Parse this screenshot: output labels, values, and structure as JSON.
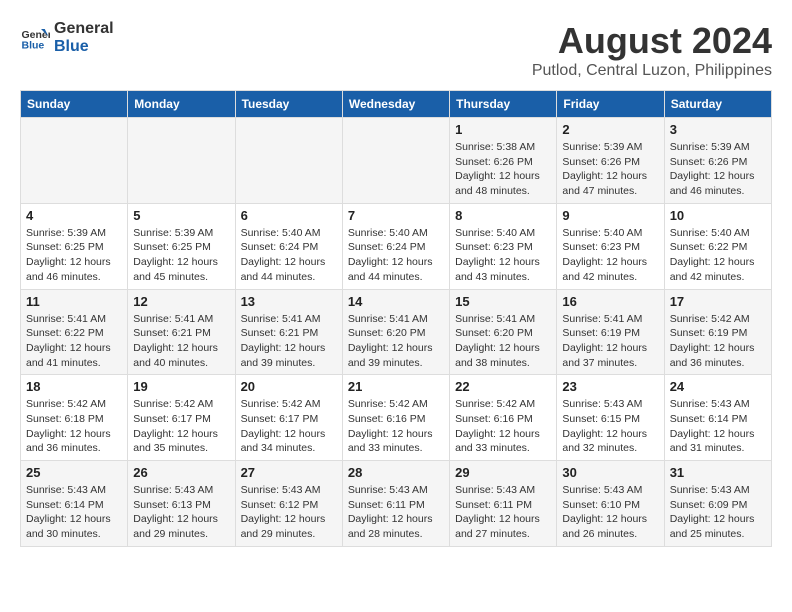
{
  "logo": {
    "line1": "General",
    "line2": "Blue"
  },
  "title": "August 2024",
  "subtitle": "Putlod, Central Luzon, Philippines",
  "days_of_week": [
    "Sunday",
    "Monday",
    "Tuesday",
    "Wednesday",
    "Thursday",
    "Friday",
    "Saturday"
  ],
  "weeks": [
    [
      {
        "day": "",
        "info": ""
      },
      {
        "day": "",
        "info": ""
      },
      {
        "day": "",
        "info": ""
      },
      {
        "day": "",
        "info": ""
      },
      {
        "day": "1",
        "info": "Sunrise: 5:38 AM\nSunset: 6:26 PM\nDaylight: 12 hours\nand 48 minutes."
      },
      {
        "day": "2",
        "info": "Sunrise: 5:39 AM\nSunset: 6:26 PM\nDaylight: 12 hours\nand 47 minutes."
      },
      {
        "day": "3",
        "info": "Sunrise: 5:39 AM\nSunset: 6:26 PM\nDaylight: 12 hours\nand 46 minutes."
      }
    ],
    [
      {
        "day": "4",
        "info": "Sunrise: 5:39 AM\nSunset: 6:25 PM\nDaylight: 12 hours\nand 46 minutes."
      },
      {
        "day": "5",
        "info": "Sunrise: 5:39 AM\nSunset: 6:25 PM\nDaylight: 12 hours\nand 45 minutes."
      },
      {
        "day": "6",
        "info": "Sunrise: 5:40 AM\nSunset: 6:24 PM\nDaylight: 12 hours\nand 44 minutes."
      },
      {
        "day": "7",
        "info": "Sunrise: 5:40 AM\nSunset: 6:24 PM\nDaylight: 12 hours\nand 44 minutes."
      },
      {
        "day": "8",
        "info": "Sunrise: 5:40 AM\nSunset: 6:23 PM\nDaylight: 12 hours\nand 43 minutes."
      },
      {
        "day": "9",
        "info": "Sunrise: 5:40 AM\nSunset: 6:23 PM\nDaylight: 12 hours\nand 42 minutes."
      },
      {
        "day": "10",
        "info": "Sunrise: 5:40 AM\nSunset: 6:22 PM\nDaylight: 12 hours\nand 42 minutes."
      }
    ],
    [
      {
        "day": "11",
        "info": "Sunrise: 5:41 AM\nSunset: 6:22 PM\nDaylight: 12 hours\nand 41 minutes."
      },
      {
        "day": "12",
        "info": "Sunrise: 5:41 AM\nSunset: 6:21 PM\nDaylight: 12 hours\nand 40 minutes."
      },
      {
        "day": "13",
        "info": "Sunrise: 5:41 AM\nSunset: 6:21 PM\nDaylight: 12 hours\nand 39 minutes."
      },
      {
        "day": "14",
        "info": "Sunrise: 5:41 AM\nSunset: 6:20 PM\nDaylight: 12 hours\nand 39 minutes."
      },
      {
        "day": "15",
        "info": "Sunrise: 5:41 AM\nSunset: 6:20 PM\nDaylight: 12 hours\nand 38 minutes."
      },
      {
        "day": "16",
        "info": "Sunrise: 5:41 AM\nSunset: 6:19 PM\nDaylight: 12 hours\nand 37 minutes."
      },
      {
        "day": "17",
        "info": "Sunrise: 5:42 AM\nSunset: 6:19 PM\nDaylight: 12 hours\nand 36 minutes."
      }
    ],
    [
      {
        "day": "18",
        "info": "Sunrise: 5:42 AM\nSunset: 6:18 PM\nDaylight: 12 hours\nand 36 minutes."
      },
      {
        "day": "19",
        "info": "Sunrise: 5:42 AM\nSunset: 6:17 PM\nDaylight: 12 hours\nand 35 minutes."
      },
      {
        "day": "20",
        "info": "Sunrise: 5:42 AM\nSunset: 6:17 PM\nDaylight: 12 hours\nand 34 minutes."
      },
      {
        "day": "21",
        "info": "Sunrise: 5:42 AM\nSunset: 6:16 PM\nDaylight: 12 hours\nand 33 minutes."
      },
      {
        "day": "22",
        "info": "Sunrise: 5:42 AM\nSunset: 6:16 PM\nDaylight: 12 hours\nand 33 minutes."
      },
      {
        "day": "23",
        "info": "Sunrise: 5:43 AM\nSunset: 6:15 PM\nDaylight: 12 hours\nand 32 minutes."
      },
      {
        "day": "24",
        "info": "Sunrise: 5:43 AM\nSunset: 6:14 PM\nDaylight: 12 hours\nand 31 minutes."
      }
    ],
    [
      {
        "day": "25",
        "info": "Sunrise: 5:43 AM\nSunset: 6:14 PM\nDaylight: 12 hours\nand 30 minutes."
      },
      {
        "day": "26",
        "info": "Sunrise: 5:43 AM\nSunset: 6:13 PM\nDaylight: 12 hours\nand 29 minutes."
      },
      {
        "day": "27",
        "info": "Sunrise: 5:43 AM\nSunset: 6:12 PM\nDaylight: 12 hours\nand 29 minutes."
      },
      {
        "day": "28",
        "info": "Sunrise: 5:43 AM\nSunset: 6:11 PM\nDaylight: 12 hours\nand 28 minutes."
      },
      {
        "day": "29",
        "info": "Sunrise: 5:43 AM\nSunset: 6:11 PM\nDaylight: 12 hours\nand 27 minutes."
      },
      {
        "day": "30",
        "info": "Sunrise: 5:43 AM\nSunset: 6:10 PM\nDaylight: 12 hours\nand 26 minutes."
      },
      {
        "day": "31",
        "info": "Sunrise: 5:43 AM\nSunset: 6:09 PM\nDaylight: 12 hours\nand 25 minutes."
      }
    ]
  ]
}
